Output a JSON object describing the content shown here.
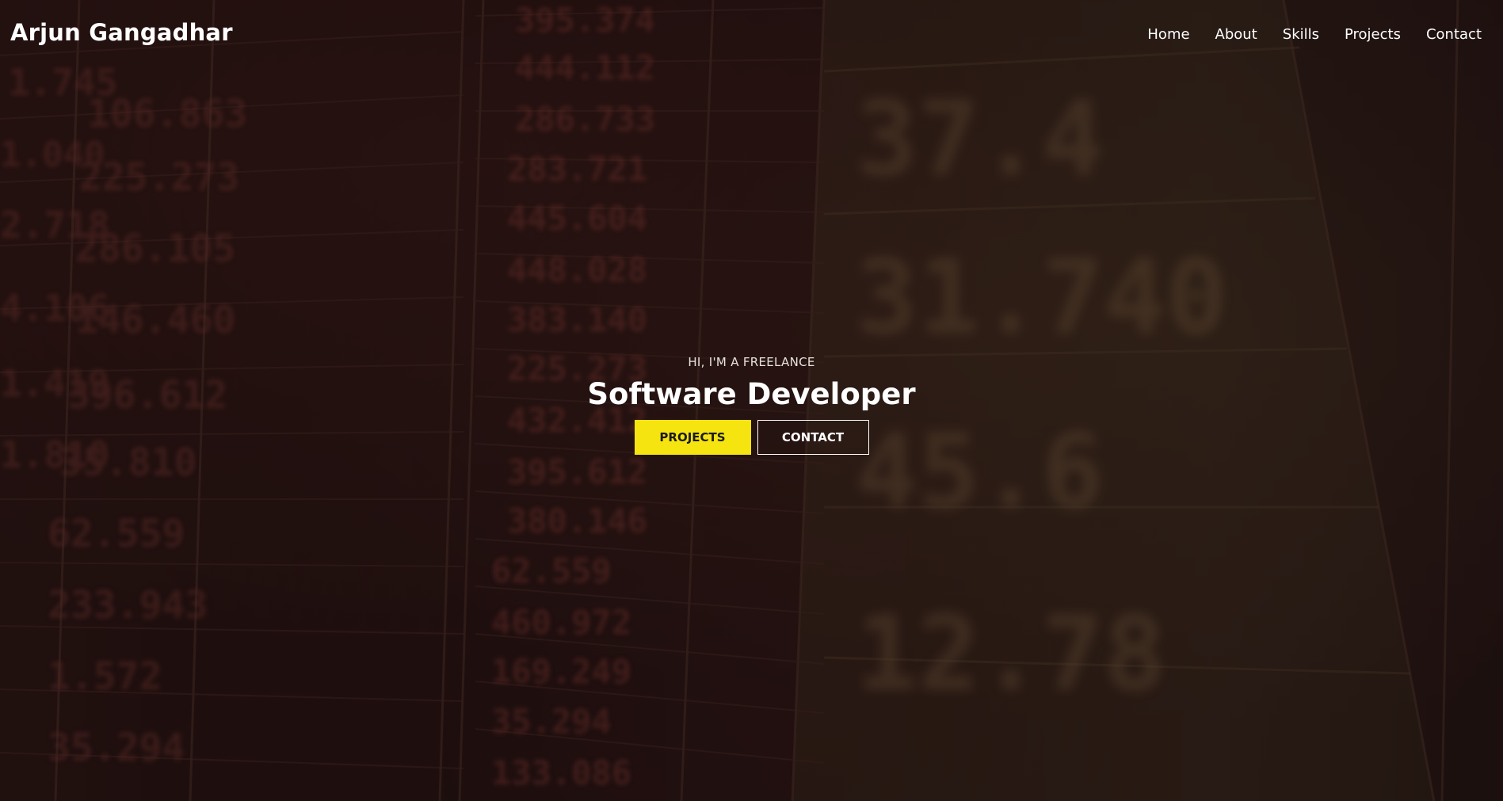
{
  "brand": {
    "name": "Arjun Gangadhar"
  },
  "nav": {
    "items": [
      {
        "label": "Home"
      },
      {
        "label": "About"
      },
      {
        "label": "Skills"
      },
      {
        "label": "Projects"
      },
      {
        "label": "Contact"
      }
    ]
  },
  "hero": {
    "subtitle": "HI, I'M A FREELANCE",
    "headline": "Software Developer",
    "primary_button": "PROJECTS",
    "secondary_button": "CONTACT",
    "background_image": "stock-ticker-board-photo"
  },
  "colors": {
    "accent": "#f5e40f",
    "text": "#ffffff",
    "overlay": "#1b0f0e"
  }
}
